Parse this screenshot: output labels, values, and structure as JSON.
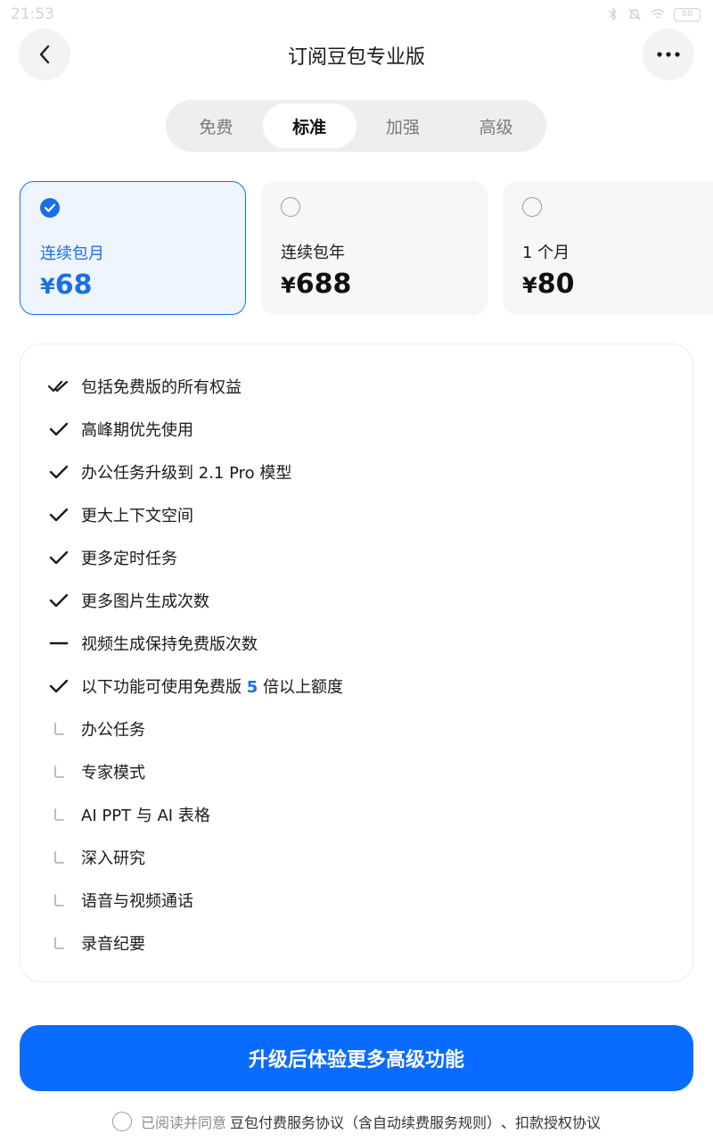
{
  "status_bar": {
    "time": "21:53",
    "battery": "68",
    "icons": [
      "bluetooth-icon",
      "mute-icon",
      "wifi-icon",
      "battery-icon"
    ]
  },
  "header": {
    "title": "订阅豆包专业版",
    "back_icon": "chevron-left-icon",
    "more_icon": "more-horizontal-icon"
  },
  "tabs": [
    {
      "label": "免费",
      "active": false
    },
    {
      "label": "标准",
      "active": true
    },
    {
      "label": "加强",
      "active": false
    },
    {
      "label": "高级",
      "active": false
    }
  ],
  "plans": [
    {
      "name": "连续包月",
      "currency": "¥",
      "price": "68",
      "selected": true
    },
    {
      "name": "连续包年",
      "currency": "¥",
      "price": "688",
      "selected": false
    },
    {
      "name": "1 个月",
      "currency": "¥",
      "price": "80",
      "selected": false
    }
  ],
  "features": [
    {
      "icon": "double-check-icon",
      "text": "包括免费版的所有权益"
    },
    {
      "icon": "check-icon",
      "text": "高峰期优先使用"
    },
    {
      "icon": "check-icon",
      "text": "办公任务升级到 2.1 Pro 模型"
    },
    {
      "icon": "check-icon",
      "text": "更大上下文空间"
    },
    {
      "icon": "check-icon",
      "text": "更多定时任务"
    },
    {
      "icon": "check-icon",
      "text": "更多图片生成次数"
    },
    {
      "icon": "dash-icon",
      "text": "视频生成保持免费版次数"
    },
    {
      "icon": "check-icon",
      "text_before": "以下功能可使用免费版 ",
      "highlight": "5",
      "text_after": " 倍以上额度"
    },
    {
      "icon": "sub-branch-icon",
      "text": "办公任务"
    },
    {
      "icon": "sub-branch-icon",
      "text": "专家模式"
    },
    {
      "icon": "sub-branch-icon",
      "text": "AI PPT 与 AI 表格"
    },
    {
      "icon": "sub-branch-icon",
      "text": "深入研究"
    },
    {
      "icon": "sub-branch-icon",
      "text": "语音与视频通话"
    },
    {
      "icon": "sub-branch-icon",
      "text": "录音纪要"
    }
  ],
  "cta": {
    "label": "升级后体验更多高级功能"
  },
  "agreement": {
    "prefix": "已阅读并同意",
    "link1": "豆包付费服务协议（含自动续费服务规则）",
    "separator": "、",
    "link2": "扣款授权协议"
  },
  "colors": {
    "accent": "#1a6fe8",
    "cta": "#0a6cff",
    "selected_bg": "#eef5ff"
  }
}
